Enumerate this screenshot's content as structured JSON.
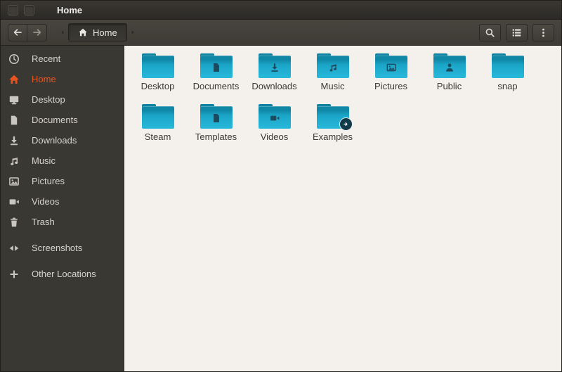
{
  "window": {
    "title": "Home"
  },
  "toolbar": {
    "path_label": "Home",
    "icons": [
      "arrow-left",
      "arrow-right",
      "chevron-left",
      "home",
      "chevron-right",
      "search",
      "list-view",
      "menu-dots"
    ]
  },
  "sidebar": {
    "items": [
      {
        "label": "Recent",
        "icon": "clock",
        "active": false,
        "gap_before": false
      },
      {
        "label": "Home",
        "icon": "home",
        "active": true,
        "gap_before": false
      },
      {
        "label": "Desktop",
        "icon": "desktop",
        "active": false,
        "gap_before": false
      },
      {
        "label": "Documents",
        "icon": "document",
        "active": false,
        "gap_before": false
      },
      {
        "label": "Downloads",
        "icon": "download",
        "active": false,
        "gap_before": false
      },
      {
        "label": "Music",
        "icon": "music-note",
        "active": false,
        "gap_before": false
      },
      {
        "label": "Pictures",
        "icon": "photo",
        "active": false,
        "gap_before": false
      },
      {
        "label": "Videos",
        "icon": "video-camera",
        "active": false,
        "gap_before": false
      },
      {
        "label": "Trash",
        "icon": "trash",
        "active": false,
        "gap_before": false
      },
      {
        "label": "Screenshots",
        "icon": "drive",
        "active": false,
        "gap_before": true
      },
      {
        "label": "Other Locations",
        "icon": "plus",
        "active": false,
        "gap_before": true
      }
    ]
  },
  "files": {
    "items": [
      {
        "name": "Desktop",
        "emblem": "none"
      },
      {
        "name": "Documents",
        "emblem": "document"
      },
      {
        "name": "Downloads",
        "emblem": "download"
      },
      {
        "name": "Music",
        "emblem": "music-note"
      },
      {
        "name": "Pictures",
        "emblem": "photo"
      },
      {
        "name": "Public",
        "emblem": "person"
      },
      {
        "name": "snap",
        "emblem": "none"
      },
      {
        "name": "Steam",
        "emblem": "none"
      },
      {
        "name": "Templates",
        "emblem": "document"
      },
      {
        "name": "Videos",
        "emblem": "video-camera"
      },
      {
        "name": "Examples",
        "emblem": "link"
      }
    ]
  },
  "colors": {
    "accent": "#E95420",
    "folder-teal": "#1BA6C8",
    "emblem-dark": "#1C4A5E"
  }
}
